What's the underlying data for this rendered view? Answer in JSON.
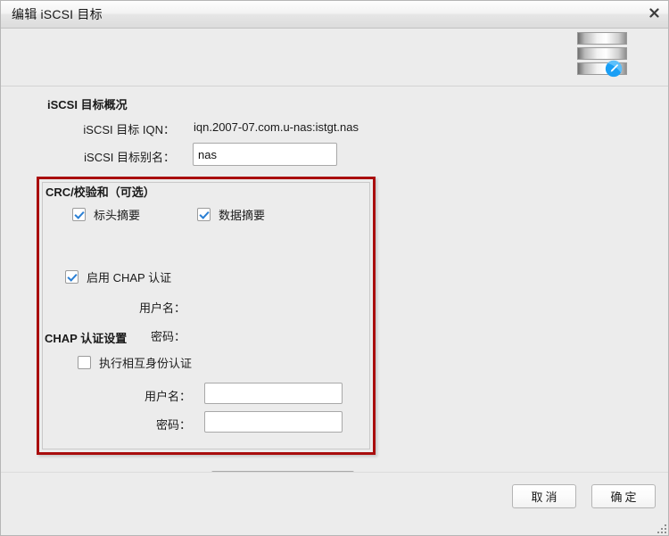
{
  "window": {
    "title": "编辑 iSCSI 目标",
    "close_label": "✕",
    "icon_name": "iscsi-target-edit-icon"
  },
  "overview": {
    "section_title": "iSCSI 目标概况",
    "iqn_label": "iSCSI 目标 IQN：",
    "iqn_value": "iqn.2007-07.com.u-nas:istgt.nas",
    "alias_label": "iSCSI 目标别名：",
    "alias_value": "nas",
    "alias_placeholder": ""
  },
  "crc": {
    "section_title": "CRC/校验和（可选）",
    "header_digest_label": "标头摘要",
    "header_digest_checked": true,
    "data_digest_label": "数据摘要",
    "data_digest_checked": true
  },
  "chap": {
    "section_title": "CHAP 认证设置",
    "enable_label": "启用 CHAP 认证",
    "enable_checked": true,
    "username_label": "用户名：",
    "username_value": "",
    "password_label": "密码：",
    "password_value": "",
    "mutual_label": "执行相互身份认证",
    "mutual_checked": false,
    "mutual_username_label": "用户名：",
    "mutual_username_value": "",
    "mutual_password_label": "密码：",
    "mutual_password_value": ""
  },
  "footer": {
    "cancel_label": "取消",
    "ok_label": "确定"
  },
  "colors": {
    "highlight_box": "#a90d0d",
    "checkmark": "#2a7fd4",
    "badge": "#1a9ff5",
    "background": "#ececec"
  }
}
